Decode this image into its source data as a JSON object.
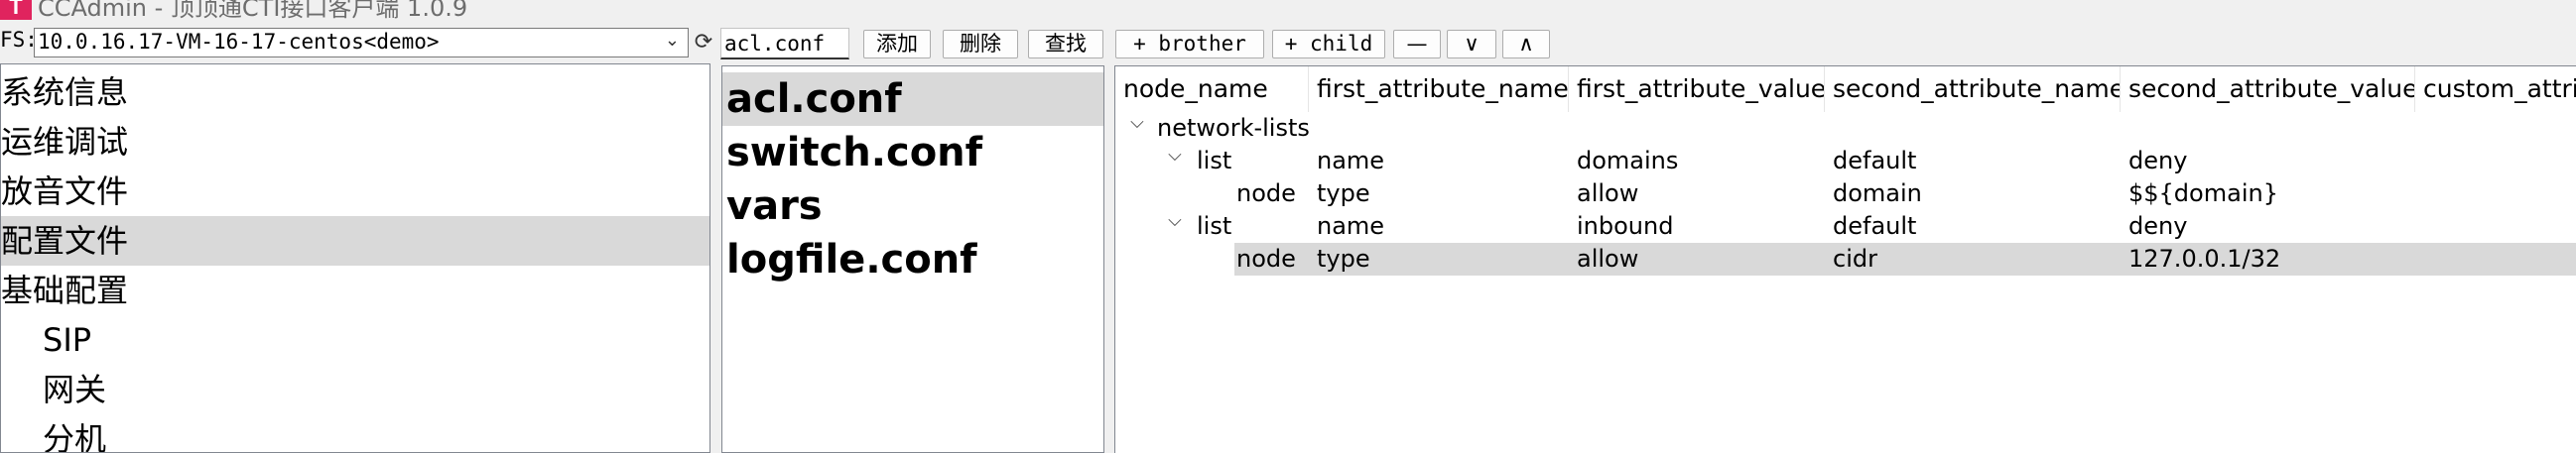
{
  "titlebar": {
    "logo": "T",
    "title": "CCAdmin - 顶顶通CTI接口客户端 1.0.9"
  },
  "toolbar": {
    "fs_label": "FS:",
    "fs_value": "10.0.16.17-VM-16-17-centos<demo>",
    "file_name": "acl.conf",
    "add_label": "添加",
    "delete_label": "删除",
    "find_label": "查找",
    "brother_label": "+ brother",
    "child_label": "+ child",
    "remove_label": "—",
    "down_label": "∨",
    "up_label": "∧"
  },
  "nav": {
    "items": [
      {
        "label": "系统信息",
        "indent": 0,
        "selected": false
      },
      {
        "label": "运维调试",
        "indent": 0,
        "selected": false
      },
      {
        "label": "放音文件",
        "indent": 0,
        "selected": false
      },
      {
        "label": "配置文件",
        "indent": 0,
        "selected": true
      },
      {
        "label": "基础配置",
        "indent": 0,
        "selected": false
      },
      {
        "label": "SIP",
        "indent": 1,
        "selected": false
      },
      {
        "label": "网关",
        "indent": 1,
        "selected": false
      },
      {
        "label": "分机",
        "indent": 1,
        "selected": false
      }
    ]
  },
  "files": {
    "items": [
      {
        "label": "acl.conf",
        "selected": true
      },
      {
        "label": "switch.conf",
        "selected": false
      },
      {
        "label": "vars",
        "selected": false
      },
      {
        "label": "logfile.conf",
        "selected": false
      }
    ]
  },
  "tree": {
    "columns": [
      "node_name",
      "first_attribute_name",
      "first_attribute_value",
      "second_attribute_name",
      "second_attribute_value",
      "custom_attribute"
    ],
    "rows": [
      {
        "node": "network-lists",
        "depth": 0,
        "expandable": true,
        "selected": false,
        "a1n": "",
        "a1v": "",
        "a2n": "",
        "a2v": ""
      },
      {
        "node": "list",
        "depth": 1,
        "expandable": true,
        "selected": false,
        "a1n": "name",
        "a1v": "domains",
        "a2n": "default",
        "a2v": "deny"
      },
      {
        "node": "node",
        "depth": 2,
        "expandable": false,
        "selected": false,
        "a1n": "type",
        "a1v": "allow",
        "a2n": "domain",
        "a2v": "$${domain}"
      },
      {
        "node": "list",
        "depth": 1,
        "expandable": true,
        "selected": false,
        "a1n": "name",
        "a1v": "inbound",
        "a2n": "default",
        "a2v": "deny"
      },
      {
        "node": "node",
        "depth": 2,
        "expandable": false,
        "selected": true,
        "a1n": "type",
        "a1v": "allow",
        "a2n": "cidr",
        "a2v": "127.0.0.1/32"
      }
    ]
  }
}
